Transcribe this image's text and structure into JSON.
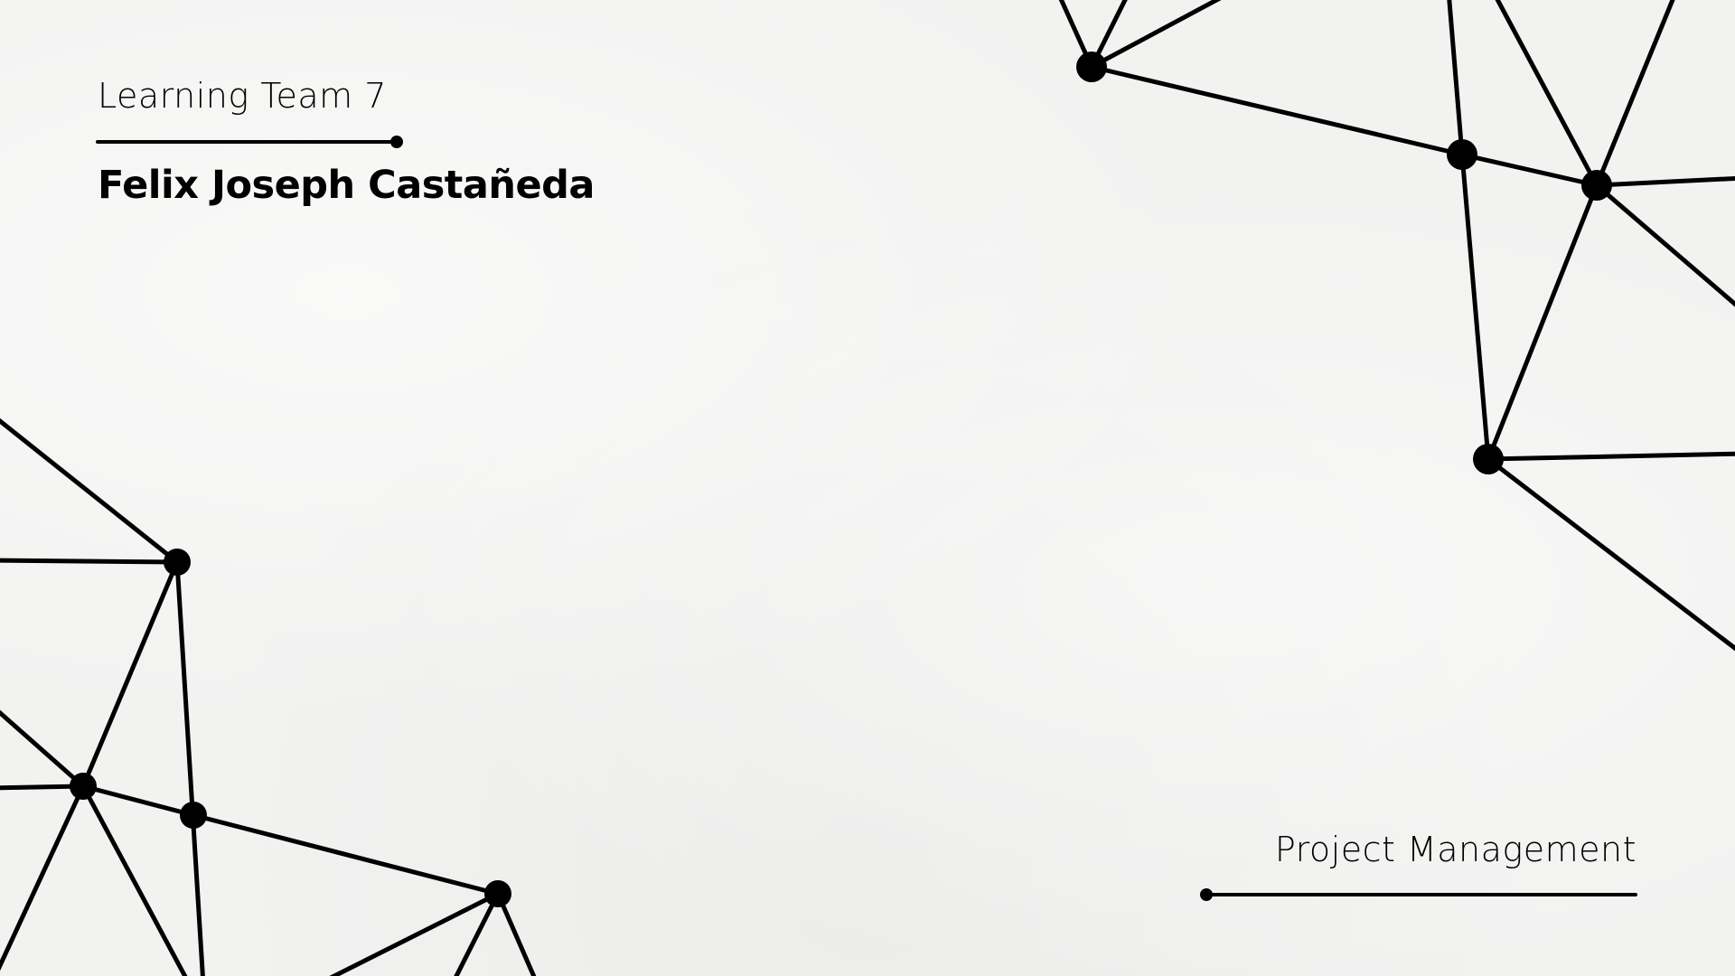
{
  "slide": {
    "subtitle": "Learning Team 7",
    "title": "Felix Joseph Castañeda",
    "topic": "Project Management"
  },
  "colors": {
    "background": "#f2f2f1",
    "ink": "#000000"
  }
}
